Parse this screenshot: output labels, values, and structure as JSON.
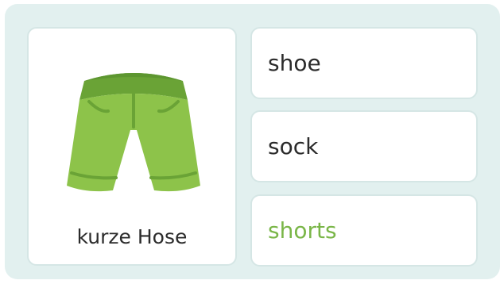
{
  "prompt_card": {
    "image_icon": "green-shorts-icon",
    "caption": "kurze Hose"
  },
  "options": [
    {
      "label": "shoe",
      "color": "#2b2b2b",
      "selected": false
    },
    {
      "label": "sock",
      "color": "#2b2b2b",
      "selected": false
    },
    {
      "label": "shorts",
      "color": "#7ab648",
      "selected": true
    }
  ],
  "colors": {
    "panel_bg": "#e2f0ef",
    "card_border": "#d5e6e5",
    "shorts_green": "#8dc34a",
    "shorts_dark": "#6aa336"
  }
}
